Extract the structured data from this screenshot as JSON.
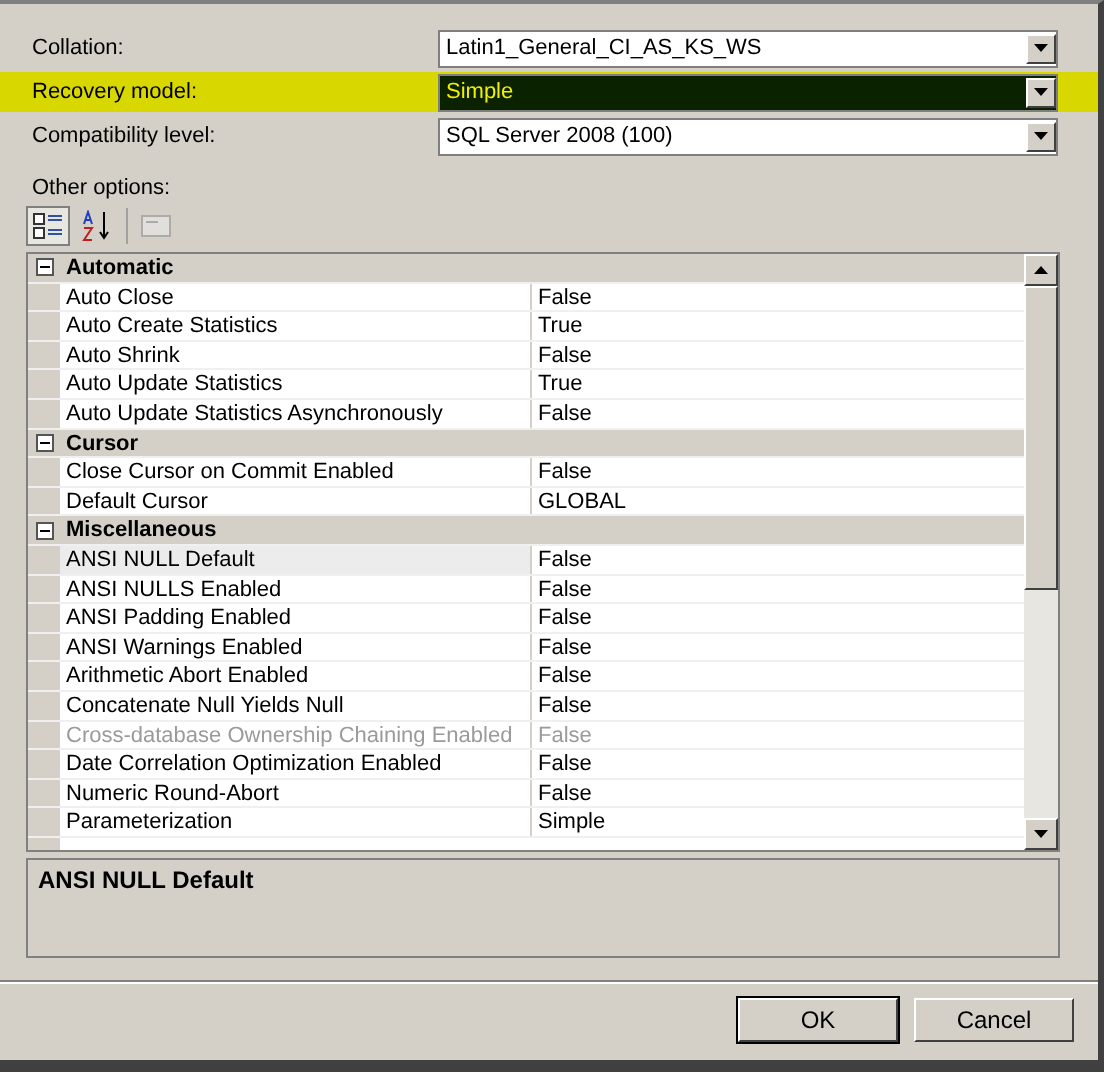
{
  "fields": [
    {
      "label": "Collation:",
      "value": "Latin1_General_CI_AS_KS_WS",
      "highlighted": false
    },
    {
      "label": "Recovery model:",
      "value": "Simple",
      "highlighted": true
    },
    {
      "label": "Compatibility level:",
      "value": "SQL Server 2008 (100)",
      "highlighted": false
    }
  ],
  "other_options_label": "Other options:",
  "toolbar": [
    {
      "kind": "categorized",
      "selected": true,
      "disabled": false
    },
    {
      "kind": "alphabetical",
      "selected": false,
      "disabled": false
    },
    {
      "kind": "property-pages",
      "selected": false,
      "disabled": true
    }
  ],
  "property_grid": [
    {
      "category": "Automatic",
      "expanded": true,
      "children": [
        {
          "name": "Auto Close",
          "value": "False",
          "disabled": false,
          "selected": false
        },
        {
          "name": "Auto Create Statistics",
          "value": "True",
          "disabled": false,
          "selected": false
        },
        {
          "name": "Auto Shrink",
          "value": "False",
          "disabled": false,
          "selected": false
        },
        {
          "name": "Auto Update Statistics",
          "value": "True",
          "disabled": false,
          "selected": false
        },
        {
          "name": "Auto Update Statistics Asynchronously",
          "value": "False",
          "disabled": false,
          "selected": false
        }
      ]
    },
    {
      "category": "Cursor",
      "expanded": true,
      "children": [
        {
          "name": "Close Cursor on Commit Enabled",
          "value": "False",
          "disabled": false,
          "selected": false
        },
        {
          "name": "Default Cursor",
          "value": "GLOBAL",
          "disabled": false,
          "selected": false
        }
      ]
    },
    {
      "category": "Miscellaneous",
      "expanded": true,
      "children": [
        {
          "name": "ANSI NULL Default",
          "value": "False",
          "disabled": false,
          "selected": true
        },
        {
          "name": "ANSI NULLS Enabled",
          "value": "False",
          "disabled": false,
          "selected": false
        },
        {
          "name": "ANSI Padding Enabled",
          "value": "False",
          "disabled": false,
          "selected": false
        },
        {
          "name": "ANSI Warnings Enabled",
          "value": "False",
          "disabled": false,
          "selected": false
        },
        {
          "name": "Arithmetic Abort Enabled",
          "value": "False",
          "disabled": false,
          "selected": false
        },
        {
          "name": "Concatenate Null Yields Null",
          "value": "False",
          "disabled": false,
          "selected": false
        },
        {
          "name": "Cross-database Ownership Chaining Enabled",
          "value": "False",
          "disabled": true,
          "selected": false
        },
        {
          "name": "Date Correlation Optimization Enabled",
          "value": "False",
          "disabled": false,
          "selected": false
        },
        {
          "name": "Numeric Round-Abort",
          "value": "False",
          "disabled": false,
          "selected": false
        },
        {
          "name": "Parameterization",
          "value": "Simple",
          "disabled": false,
          "selected": false
        }
      ]
    }
  ],
  "description": {
    "title": "ANSI NULL Default"
  },
  "buttons": [
    {
      "label": "OK",
      "default": true
    },
    {
      "label": "Cancel",
      "default": false
    }
  ]
}
